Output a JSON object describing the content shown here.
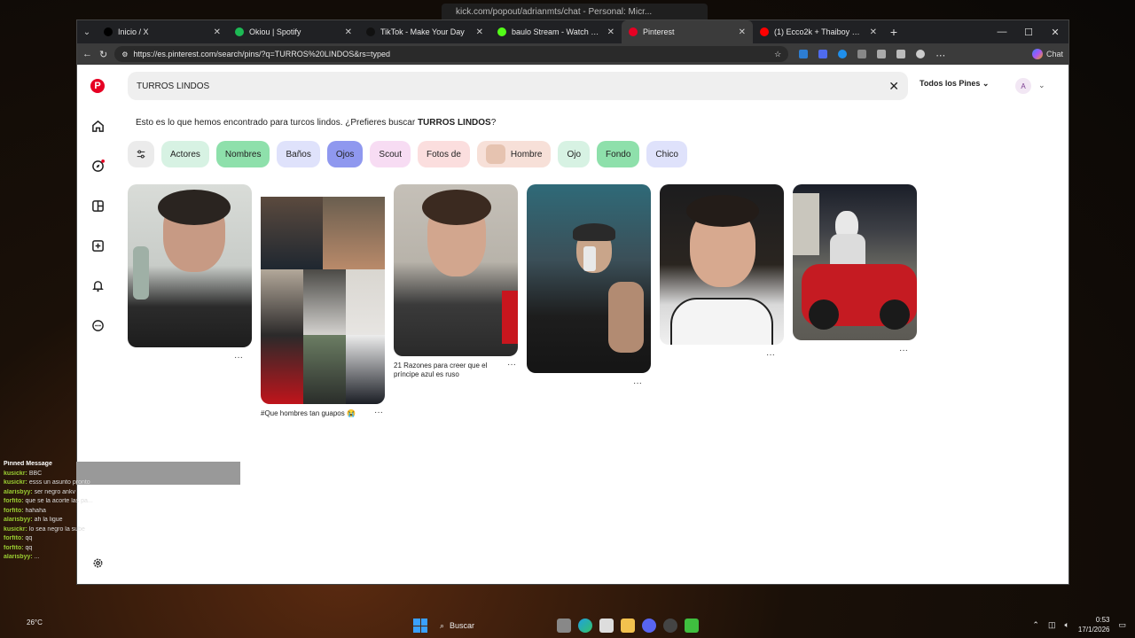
{
  "background_window": {
    "title": "kick.com/popout/adrianmts/chat - Personal: Micr..."
  },
  "browser": {
    "tabs": [
      {
        "title": "Inicio / X",
        "color": "#000000",
        "icon": "x-logo-icon"
      },
      {
        "title": "Okiou | Spotify",
        "color": "#1db954",
        "icon": "spotify-icon"
      },
      {
        "title": "TikTok - Make Your Day",
        "color": "#111111",
        "icon": "tiktok-icon"
      },
      {
        "title": "baulo Stream - Watch Live on Kick",
        "color": "#53fc18",
        "icon": "kick-icon"
      },
      {
        "title": "Pinterest",
        "color": "#e60023",
        "icon": "pinterest-icon",
        "active": true
      },
      {
        "title": "(1) Ecco2k + Thaiboy Digital",
        "color": "#ff0000",
        "icon": "youtube-icon"
      }
    ],
    "url": "https://es.pinterest.com/search/pins/?q=TURROS%20LINDOS&rs=typed",
    "chat_label": "Chat"
  },
  "pinterest": {
    "search_value": "TURROS LINDOS",
    "scope_label": "Todos los Pines",
    "avatar_initial": "A",
    "suggestion": {
      "prefix": "Esto es lo que hemos encontrado para turcos lindos. ¿Prefieres buscar ",
      "query": "TURROS LINDOS",
      "suffix": "?"
    },
    "chips": [
      {
        "label": "Actores",
        "bg": "#d7f2e3"
      },
      {
        "label": "Nombres",
        "bg": "#8ee0ab"
      },
      {
        "label": "Baños",
        "bg": "#dfe2fb"
      },
      {
        "label": "Ojos",
        "bg": "#8f98ef"
      },
      {
        "label": "Scout",
        "bg": "#f7dcf3"
      },
      {
        "label": "Fotos de",
        "bg": "#fbdede"
      },
      {
        "label": "Hombre",
        "bg": "#f7e0d8",
        "thumb": true
      },
      {
        "label": "Ojo",
        "bg": "#d7f2e3"
      },
      {
        "label": "Fondo",
        "bg": "#8ee0ab"
      },
      {
        "label": "Chico",
        "bg": "#dfe2fb"
      }
    ],
    "pins": [
      {
        "caption": "",
        "has_more": true
      },
      {
        "caption": "#Que hombres tan guapos 😭",
        "has_more": true
      },
      {
        "caption": "21 Razones para creer que el príncipe azul es ruso",
        "has_more": true
      },
      {
        "caption": "",
        "has_more": true
      },
      {
        "caption": "",
        "has_more": true
      },
      {
        "caption": "",
        "has_more": true
      }
    ],
    "more_glyph": "···"
  },
  "chat_overlay": {
    "header": "Pinned Message",
    "lines": [
      {
        "user": "kusickr:",
        "text": "BBC"
      },
      {
        "user": "kusickr:",
        "text": "esss un asunto pronto"
      },
      {
        "user": "alarisbyy:",
        "text": "ser negro ankv"
      },
      {
        "user": "forfito:",
        "text": "que se la acorte las pa..."
      },
      {
        "user": "forfito:",
        "text": "hahaha"
      },
      {
        "user": "alarisbyy:",
        "text": "ah la ligue"
      },
      {
        "user": "kusickr:",
        "text": "lo sea negro la sube"
      },
      {
        "user": "forfito:",
        "text": "qq"
      },
      {
        "user": "forfito:",
        "text": "qq"
      },
      {
        "user": "alarisbyy:",
        "text": "..."
      }
    ]
  },
  "taskbar": {
    "search_label": "Buscar",
    "time": "0:53",
    "date": "17/1/2026",
    "temperature": "26°C"
  }
}
